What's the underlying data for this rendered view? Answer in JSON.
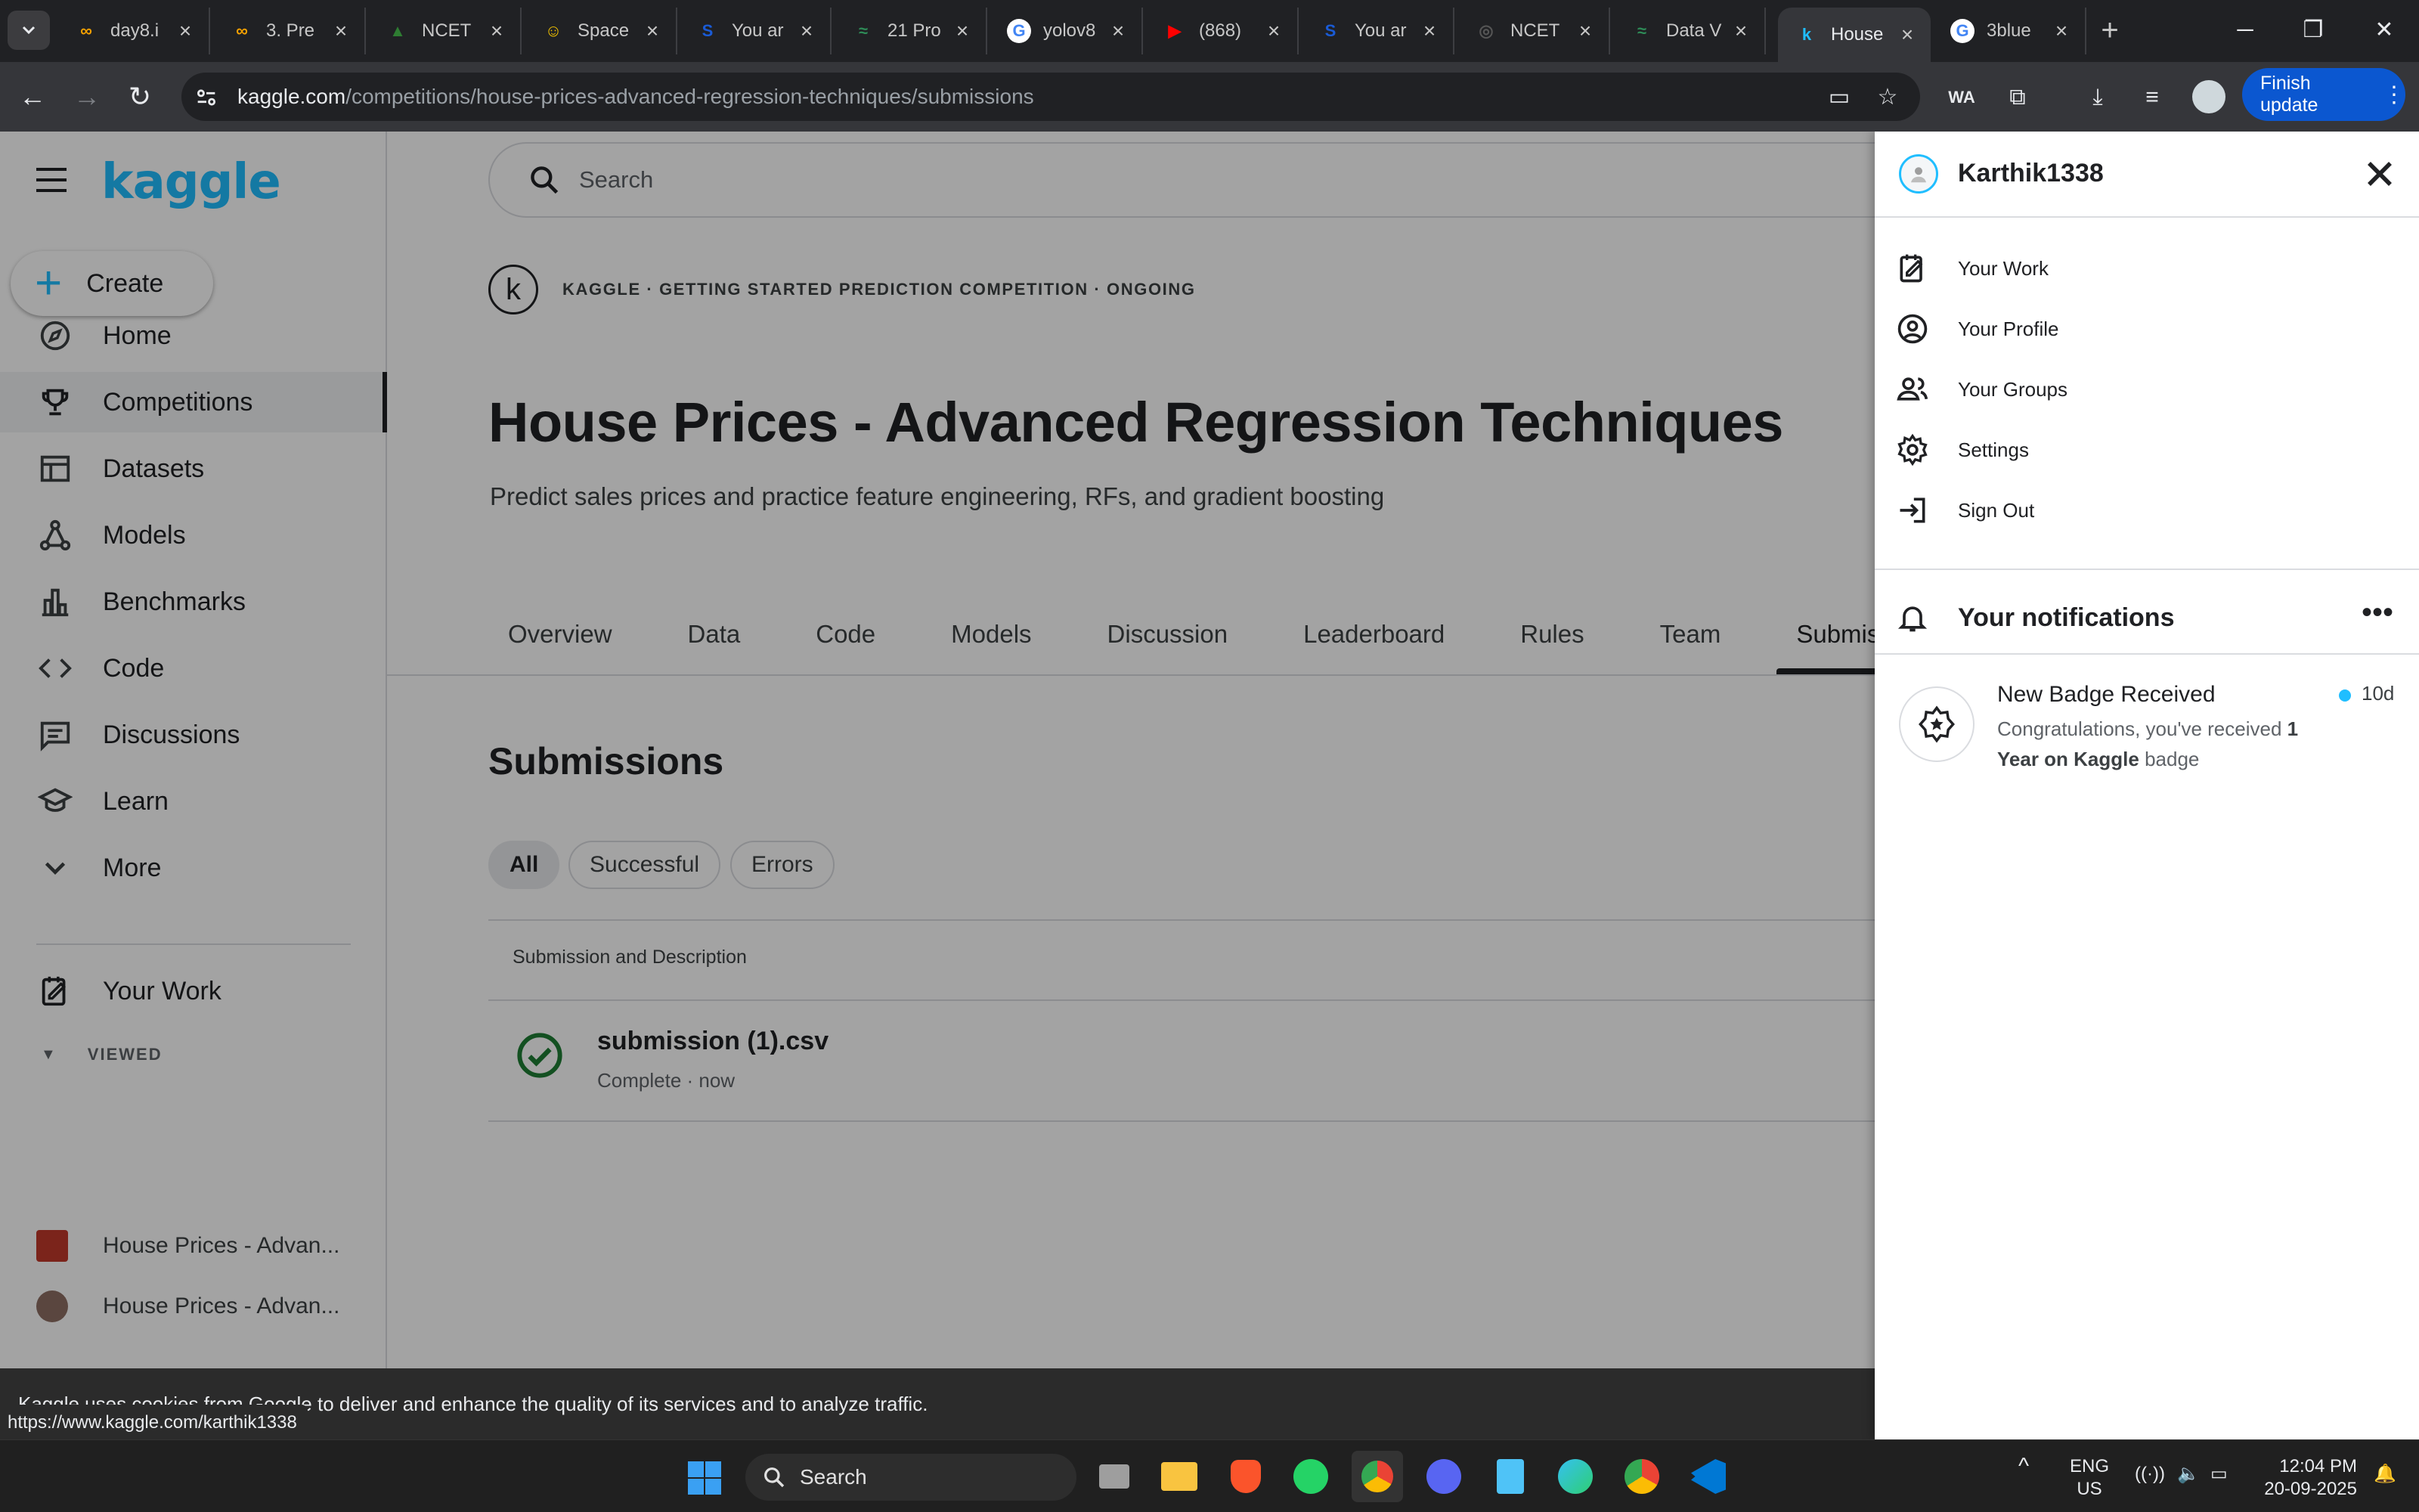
{
  "browser": {
    "tabs": [
      {
        "title": "day8.i",
        "fav_color": "#f4a100",
        "glyph": "∞"
      },
      {
        "title": "3. Pre",
        "fav_color": "#f4a100",
        "glyph": "∞"
      },
      {
        "title": "NCET",
        "fav_color": "#2e7d32",
        "glyph": "▲"
      },
      {
        "title": "Space",
        "fav_color": "#f5c400",
        "glyph": "☺"
      },
      {
        "title": "You ar",
        "fav_color": "#1a5bd6",
        "glyph": "S"
      },
      {
        "title": "21 Pro",
        "fav_color": "#2e8b57",
        "glyph": "≈"
      },
      {
        "title": "yolov8",
        "fav_color": "#ffffff",
        "glyph": "G"
      },
      {
        "title": "(868)",
        "fav_color": "#ff0000",
        "glyph": "▶"
      },
      {
        "title": "You ar",
        "fav_color": "#1a5bd6",
        "glyph": "S"
      },
      {
        "title": "NCET",
        "fav_color": "#555555",
        "glyph": "◎"
      },
      {
        "title": "Data V",
        "fav_color": "#2e8b57",
        "glyph": "≈"
      },
      {
        "title": "House",
        "fav_color": "#20beff",
        "glyph": "k"
      },
      {
        "title": "3blue",
        "fav_color": "#ffffff",
        "glyph": "G"
      }
    ],
    "url_domain": "kaggle.com",
    "url_path": "/competitions/house-prices-advanced-regression-techniques/submissions",
    "finish_update": "Finish update",
    "ext_label": "WA"
  },
  "sidebar": {
    "logo": "kaggle",
    "create": "Create",
    "items": [
      {
        "label": "Home",
        "icon": "compass-icon"
      },
      {
        "label": "Competitions",
        "icon": "trophy-icon"
      },
      {
        "label": "Datasets",
        "icon": "table-icon"
      },
      {
        "label": "Models",
        "icon": "models-icon"
      },
      {
        "label": "Benchmarks",
        "icon": "bar-chart-icon"
      },
      {
        "label": "Code",
        "icon": "code-icon"
      },
      {
        "label": "Discussions",
        "icon": "comments-icon"
      },
      {
        "label": "Learn",
        "icon": "school-icon"
      },
      {
        "label": "More",
        "icon": "chevron-down-icon"
      }
    ],
    "your_work": "Your Work",
    "viewed_label": "VIEWED",
    "viewed": [
      "House Prices - Advan...",
      "House Prices - Advan..."
    ]
  },
  "main": {
    "search_placeholder": "Search",
    "competition_meta": "KAGGLE · GETTING STARTED PREDICTION COMPETITION · ONGOING",
    "title": "House Prices - Advanced Regression Techniques",
    "subtitle": "Predict sales prices and practice feature engineering, RFs, and gradient boosting",
    "tabs": [
      "Overview",
      "Data",
      "Code",
      "Models",
      "Discussion",
      "Leaderboard",
      "Rules",
      "Team",
      "Submissions"
    ],
    "active_tab": "Submissions",
    "section_title": "Submissions",
    "filters": [
      "All",
      "Successful",
      "Errors"
    ],
    "table_header": "Submission and Description",
    "submission": {
      "name": "submission (1).csv",
      "status": "Complete · now"
    }
  },
  "cookie_banner": "Kaggle uses cookies from Google to deliver and enhance the quality of its services and to analyze traffic.",
  "status_url": "https://www.kaggle.com/karthik1338",
  "panel": {
    "username": "Karthik1338",
    "menu": [
      {
        "label": "Your Work",
        "icon": "edit-note-icon"
      },
      {
        "label": "Your Profile",
        "icon": "profile-icon"
      },
      {
        "label": "Your Groups",
        "icon": "groups-icon"
      },
      {
        "label": "Settings",
        "icon": "gear-icon"
      },
      {
        "label": "Sign Out",
        "icon": "sign-out-icon"
      }
    ],
    "notifications_title": "Your notifications",
    "notification": {
      "title": "New Badge Received",
      "body_pre": "Congratulations, you've received ",
      "body_bold": "1 Year on Kaggle",
      "body_post": " badge",
      "time": "10d"
    }
  },
  "taskbar": {
    "search": "Search",
    "lang_top": "ENG",
    "lang_bottom": "US",
    "time": "12:04 PM",
    "date": "20-09-2025"
  },
  "colors": {
    "accent": "#20beff",
    "success": "#1e7e34",
    "update_button": "#0b57d0"
  }
}
